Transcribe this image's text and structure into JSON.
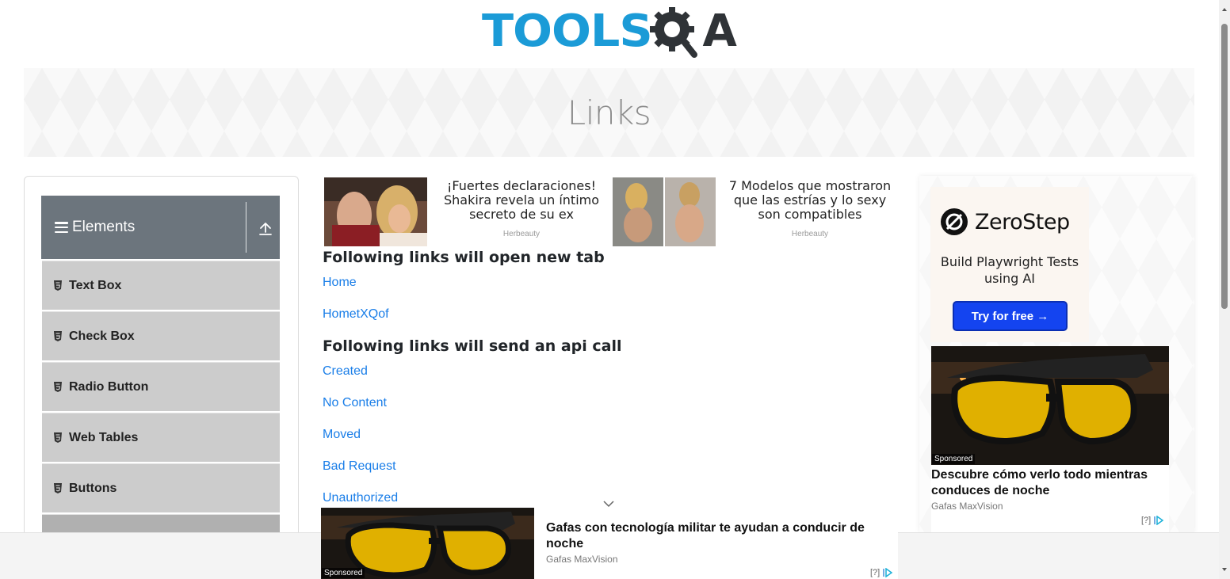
{
  "logo": {
    "text_left": "TOOLS",
    "text_right": "A"
  },
  "page_title": "Links",
  "sidebar": {
    "group_title": "Elements",
    "items": [
      {
        "label": "Text Box"
      },
      {
        "label": "Check Box"
      },
      {
        "label": "Radio Button"
      },
      {
        "label": "Web Tables"
      },
      {
        "label": "Buttons"
      }
    ]
  },
  "ads_top": [
    {
      "text": "¡Fuertes declaraciones! Shakira revela un íntimo secreto de su ex",
      "source": "Herbeauty"
    },
    {
      "text": "7 Modelos que mostraron que las estrías y lo sexy son compatibles",
      "source": "Herbeauty"
    }
  ],
  "section_new_tab": {
    "heading": "Following links will open new tab",
    "links": [
      "Home",
      "HometXQof"
    ]
  },
  "section_api": {
    "heading": "Following links will send an api call",
    "links": [
      "Created",
      "No Content",
      "Moved",
      "Bad Request",
      "Unauthorized"
    ]
  },
  "right_ad": {
    "brand_name": "ZeroStep",
    "tagline": "Build Playwright Tests using AI",
    "cta": "Try for free →",
    "sponsored": "Sponsored",
    "headline": "Descubre cómo verlo todo mientras conduces de noche",
    "advertiser": "Gafas MaxVision",
    "qmark": "[?]"
  },
  "bottom_ad": {
    "sponsored": "Sponsored",
    "headline": "Gafas con tecnología militar te ayudan a conducir de noche",
    "advertiser": "Gafas MaxVision",
    "qmark": "[?]"
  },
  "colors": {
    "logo_blue": "#1b9bd7",
    "logo_dark": "#2f3337",
    "link": "#1a7ee8",
    "group_header": "#6c757d",
    "menu_item": "#cccccc",
    "cta_blue": "#1444f0"
  }
}
